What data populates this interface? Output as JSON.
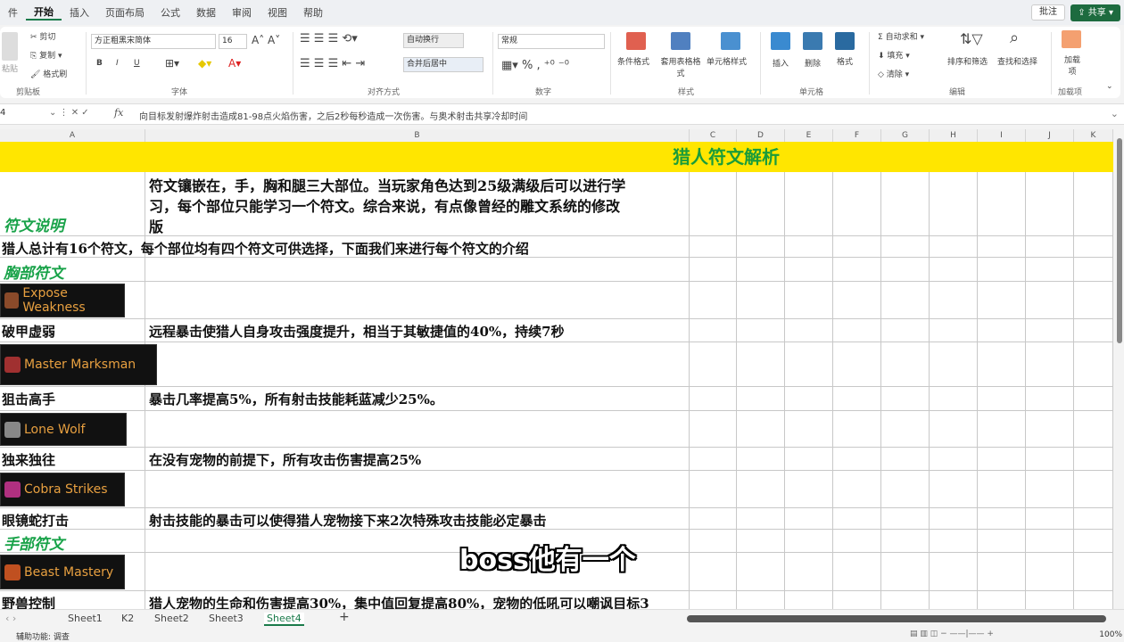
{
  "menu": {
    "tabs": [
      "件",
      "开始",
      "插入",
      "页面布局",
      "公式",
      "数据",
      "审阅",
      "视图",
      "帮助"
    ],
    "active": 1,
    "comment": "批注",
    "share": "共享"
  },
  "ribbon": {
    "cut": "剪切",
    "copy": "复制",
    "format_painter": "格式刷",
    "paste": "粘贴",
    "clipboard": "剪贴板",
    "font_name": "方正粗黑宋简体",
    "font_size": "16",
    "font_group": "字体",
    "wrap": "自动换行",
    "merge": "合并后居中",
    "align_group": "对齐方式",
    "number_format": "常规",
    "number_group": "数字",
    "cond_format": "条件格式",
    "table_format": "套用表格格式",
    "cell_style": "单元格样式",
    "style_group": "样式",
    "insert": "插入",
    "delete": "删除",
    "format": "格式",
    "cells_group": "单元格",
    "autosum": "自动求和",
    "fill": "填充",
    "clear": "清除",
    "sort_filter": "排序和筛选",
    "find_select": "查找和选择",
    "edit_group": "编辑",
    "addins": "加载项",
    "addins_group": "加载项",
    "bold": "B",
    "italic": "I",
    "underline": "U",
    "percent": "%",
    "comma": ","
  },
  "formula": {
    "name_box": "4",
    "fx": "fx",
    "value": "向目标发射爆炸射击造成81-98点火焰伤害，之后2秒每秒造成一次伤害。与奥术射击共享冷却时间"
  },
  "columns": [
    "A",
    "B",
    "C",
    "D",
    "E",
    "F",
    "G",
    "H",
    "I",
    "J",
    "K"
  ],
  "sheet": {
    "title": "猎人符文解析",
    "intro_label": "符文说明",
    "intro_text": [
      "符文镶嵌在，手，胸和腿三大部位。当玩家角色达到25级满级后可以进行学",
      "习，每个部位只能学习一个符文。综合来说，有点像曾经的雕文系统的修改",
      "版"
    ],
    "summary": "猎人总计有16个符文，每个部位均有四个符文可供选择，下面我们来进行每个符文的介绍",
    "chest_label": "胸部符文",
    "hand_label": "手部符文",
    "runes": [
      {
        "image_text": "Expose Weakness",
        "name": "破甲虚弱",
        "desc": "远程暴击使猎人自身攻击强度提升，相当于其敏捷值的40%，持续7秒",
        "color": "#8a4a2a"
      },
      {
        "image_text": "Master Marksman",
        "name": "狙击高手",
        "desc": "暴击几率提高5%，所有射击技能耗蓝减少25%。",
        "color": "#a03030"
      },
      {
        "image_text": "Lone Wolf",
        "name": "独来独往",
        "desc": "在没有宠物的前提下，所有攻击伤害提高25%",
        "color": "#888888"
      },
      {
        "image_text": "Cobra Strikes",
        "name": "眼镜蛇打击",
        "desc": "射击技能的暴击可以使得猎人宠物接下来2次特殊攻击技能必定暴击",
        "color": "#b03080"
      },
      {
        "image_text": "Beast Mastery",
        "name": "野兽控制",
        "desc": "猎人宠物的生命和伤害提高30%，集中值回复提高80%，宠物的低吼可以嘲讽目标3",
        "color": "#c05020"
      }
    ]
  },
  "sheets": {
    "tabs": [
      "Sheet1",
      "K2",
      "Sheet2",
      "Sheet3",
      "Sheet4"
    ],
    "active": 4,
    "add": "+"
  },
  "status": {
    "text": "辅助功能: 调查",
    "zoom": "100%"
  },
  "subtitle": "boss他有一个"
}
